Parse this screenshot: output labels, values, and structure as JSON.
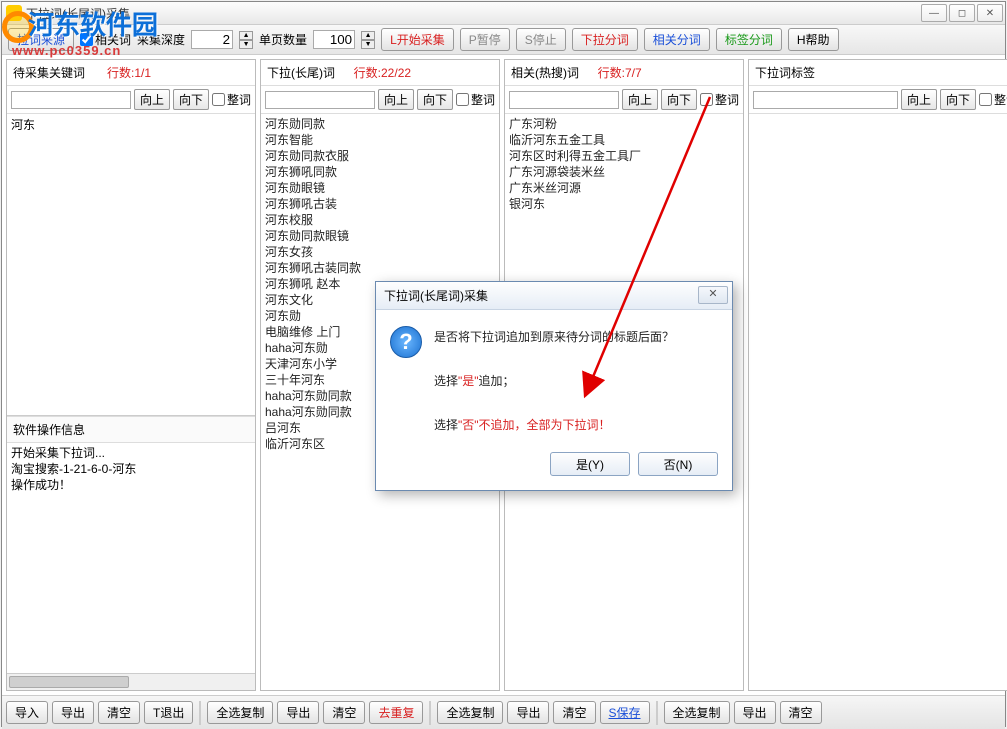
{
  "window": {
    "title": "下拉词(长尾词)采集"
  },
  "winbtns": {
    "min": "—",
    "max": "◻",
    "close": "✕"
  },
  "toolbar": {
    "source": "拉词来源",
    "related_chk": "相关词",
    "depth_label": "采集深度",
    "depth_value": "2",
    "pagesize_label": "单页数量",
    "pagesize_value": "100",
    "start": "L开始采集",
    "pause": "P暂停",
    "stop": "S停止",
    "dropdown_split": "下拉分词",
    "related_split": "相关分词",
    "tag_split": "标签分词",
    "help": "H帮助"
  },
  "col1": {
    "title": "待采集关键词",
    "count": "行数:1/1",
    "up": "向上",
    "down": "向下",
    "whole": "整词",
    "items": [
      "河东"
    ],
    "info_title": "软件操作信息",
    "info_lines": [
      "开始采集下拉词...",
      "淘宝搜索-1-21-6-0-河东",
      "操作成功！"
    ]
  },
  "col2": {
    "title": "下拉(长尾)词",
    "count": "行数:22/22",
    "up": "向上",
    "down": "向下",
    "whole": "整词",
    "items": [
      "河东勋同款",
      "河东智能",
      "河东勋同款衣服",
      "河东狮吼同款",
      "河东勋眼镜",
      "河东狮吼古装",
      "河东校服",
      "河东勋同款眼镜",
      "河东女孩",
      "河东狮吼古装同款",
      "河东狮吼 赵本",
      "河东文化",
      "河东勋",
      "电脑维修  上门",
      "haha河东勋",
      "天津河东小学",
      "三十年河东",
      "haha河东勋同款",
      "haha河东勋同款",
      "吕河东",
      "临沂河东区"
    ]
  },
  "col3": {
    "title": "相关(热搜)词",
    "count": "行数:7/7",
    "up": "向上",
    "down": "向下",
    "whole": "整词",
    "items": [
      "广东河粉",
      "临沂河东五金工具",
      "河东区时利得五金工具厂",
      "广东河源袋装米丝",
      "广东米丝河源",
      "银河东"
    ]
  },
  "col4": {
    "title": "下拉词标签",
    "up": "向上",
    "down": "向下",
    "whole": "整词"
  },
  "bottom": {
    "g1": {
      "import": "导入",
      "export": "导出",
      "clear": "清空",
      "exit": "T退出"
    },
    "g2": {
      "selcopy": "全选复制",
      "export": "导出",
      "clear": "清空",
      "dedup": "去重复"
    },
    "g3": {
      "selcopy": "全选复制",
      "export": "导出",
      "clear": "清空",
      "save": "S保存"
    },
    "g4": {
      "selcopy": "全选复制",
      "export": "导出",
      "clear": "清空"
    }
  },
  "dialog": {
    "title": "下拉词(长尾词)采集",
    "line1": "是否将下拉词追加到原来待分词的标题后面？",
    "line2a": "选择",
    "line2b": "\"是\"",
    "line2c": "追加；",
    "line3a": "选择",
    "line3b": "\"否\"",
    "line3c": "不追加，全部为下拉词！",
    "yes": "是(Y)",
    "no": "否(N)"
  },
  "watermark": {
    "text": "河东软件园",
    "url": "www.pc0359.cn"
  }
}
